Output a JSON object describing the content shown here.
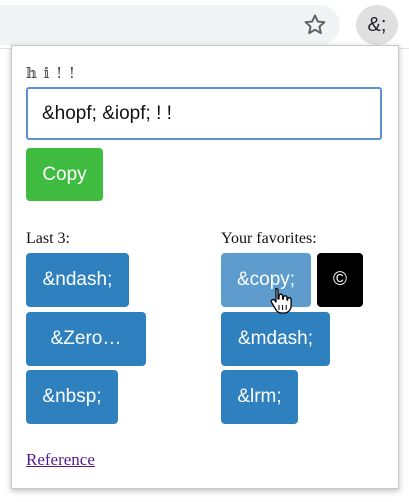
{
  "toolbar": {
    "extension_icon_label": "&;",
    "star_icon": "star-outline-icon"
  },
  "popup": {
    "preview_text": "𝕙 𝕚 ! !",
    "input_value": "&hopf; &iopf; ! !",
    "copy_label": "Copy",
    "last_heading": "Last 3:",
    "last_items": [
      "&ndash;",
      "&Zero…",
      "&nbsp;"
    ],
    "favorites_heading": "Your favorites:",
    "favorite_items": [
      "&copy;",
      "&mdash;",
      "&lrm;"
    ],
    "hovered_preview": "©",
    "reference_link": "Reference"
  },
  "colors": {
    "copy_button": "#3fbc3f",
    "entity_button": "#2f80bf",
    "entity_button_hover": "#5d9ccd",
    "input_border": "#5b8fd6",
    "link": "#551a8b"
  }
}
